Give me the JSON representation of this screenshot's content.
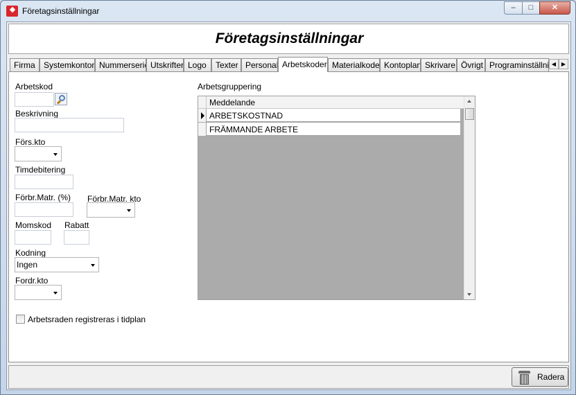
{
  "window": {
    "title": "Företagsinställningar",
    "controls": {
      "minimize": "‒",
      "maximize": "□",
      "close": "✕"
    }
  },
  "header": {
    "title": "Företagsinställningar"
  },
  "tabs": [
    {
      "label": "Firma"
    },
    {
      "label": "Systemkonton"
    },
    {
      "label": "Nummerserier"
    },
    {
      "label": "Utskrifter"
    },
    {
      "label": "Logo"
    },
    {
      "label": "Texter"
    },
    {
      "label": "Personal"
    },
    {
      "label": "Arbetskoder",
      "active": true
    },
    {
      "label": "Materialkoder"
    },
    {
      "label": "Kontoplan"
    },
    {
      "label": "Skrivare"
    },
    {
      "label": "Övrigt"
    },
    {
      "label": "Programinställningar"
    }
  ],
  "form": {
    "arbetskod": {
      "label": "Arbetskod",
      "value": ""
    },
    "beskrivning": {
      "label": "Beskrivning",
      "value": ""
    },
    "fors_kto": {
      "label": "Förs.kto",
      "value": ""
    },
    "timdebitering": {
      "label": "Timdebitering",
      "value": ""
    },
    "forbr_matr_pct": {
      "label": "Förbr.Matr. (%)",
      "value": ""
    },
    "forbr_matr_kto": {
      "label": "Förbr.Matr. kto",
      "value": ""
    },
    "momskod": {
      "label": "Momskod",
      "value": ""
    },
    "rabatt": {
      "label": "Rabatt",
      "value": ""
    },
    "kodning": {
      "label": "Kodning",
      "value": "Ingen"
    },
    "fordr_kto": {
      "label": "Fordr.kto",
      "value": ""
    },
    "tidplan_checkbox": {
      "label": "Arbetsraden registreras i tidplan",
      "checked": false
    }
  },
  "arbetsgruppering": {
    "label": "Arbetsgruppering",
    "column": "Meddelande",
    "rows": [
      "ARBETSKOSTNAD",
      "FRÄMMANDE ARBETE"
    ],
    "selected_row": 0
  },
  "footer": {
    "delete_label": "Radera"
  }
}
